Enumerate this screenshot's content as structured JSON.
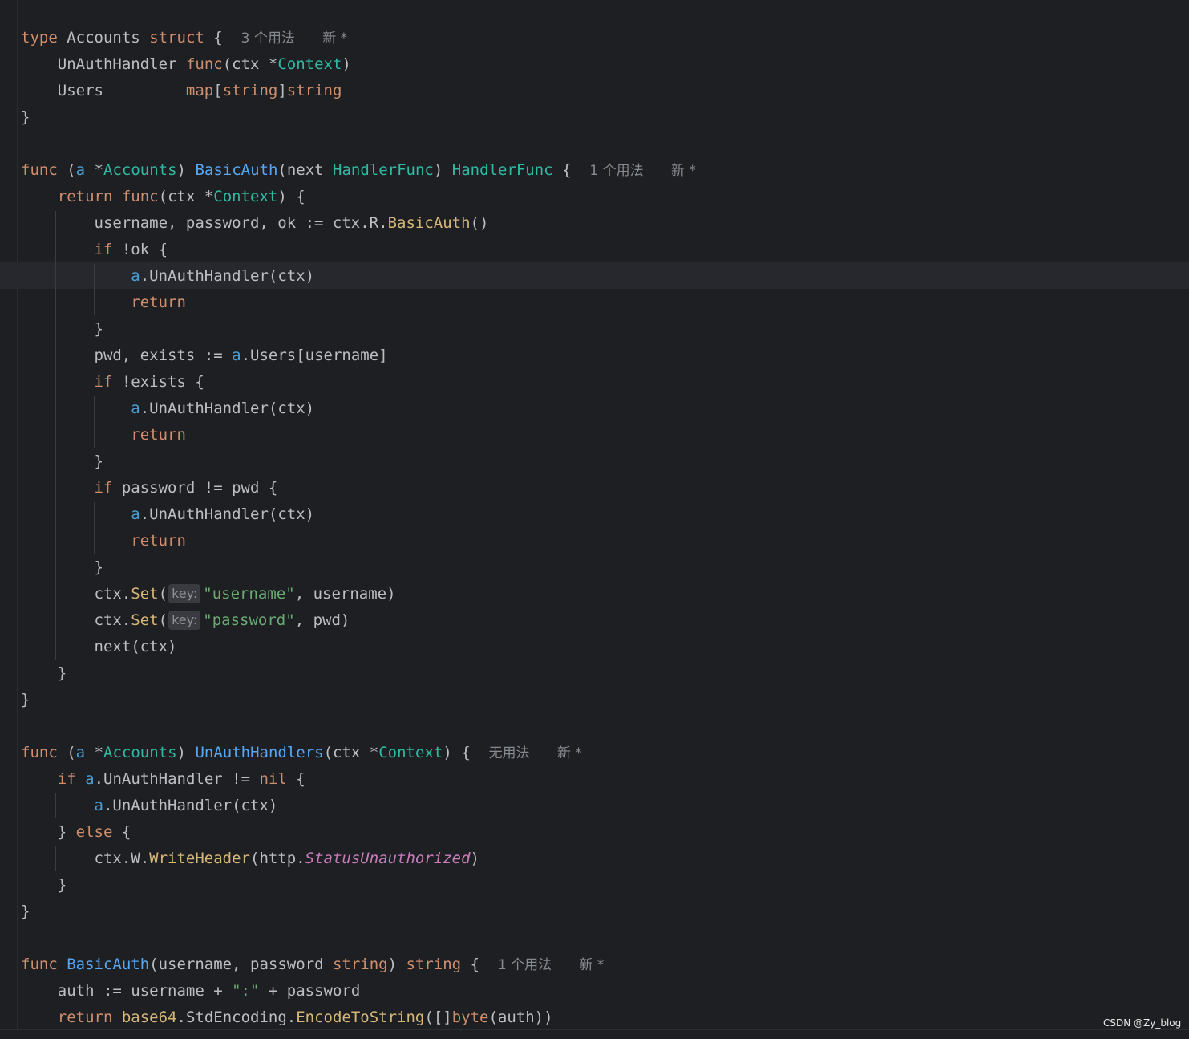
{
  "editor": {
    "lang": "go",
    "colors": {
      "background": "#1e1f22",
      "keyword": "#cf8e6d",
      "type": "#56a8f5",
      "string": "#6aab73",
      "method": "#d5b778",
      "constant": "#c77dbb"
    },
    "lines": {
      "l1": {
        "kw": "type",
        "name": "Accounts",
        "kw2": "struct",
        "brace": "{",
        "hint": "3 个用法",
        "new": "新 *"
      },
      "l2": {
        "field": "UnAuthHandler",
        "kw": "func",
        "p1": "(ctx *",
        "type": "Context",
        "p2": ")"
      },
      "l3": {
        "field": "Users",
        "map": "map",
        "b1": "[",
        "s1": "string",
        "b2": "]",
        "s2": "string"
      },
      "l4": {
        "text": "}"
      },
      "l6": {
        "kw": "func",
        "p1": "(",
        "recv": "a",
        "p2": " *",
        "type": "Accounts",
        "p3": ")",
        "name": "BasicAuth",
        "p4": "(next ",
        "t1": "HandlerFunc",
        "p5": ") ",
        "t2": "HandlerFunc",
        "brace": "{",
        "hint": "1 个用法",
        "new": "新 *"
      },
      "l7": {
        "kw": "return",
        "kw2": "func",
        "p1": "(ctx *",
        "type": "Context",
        "p2": ") {"
      },
      "l8": {
        "p1": "username, password, ok := ctx.R.",
        "call": "BasicAuth",
        "p2": "()"
      },
      "l9": {
        "kw": "if",
        "p1": " !ok {"
      },
      "l10": {
        "recv": "a",
        "p1": ".UnAuthHandler(ctx)"
      },
      "l11": {
        "kw": "return"
      },
      "l12": {
        "text": "}"
      },
      "l13": {
        "p1": "pwd, exists := ",
        "recv": "a",
        "p2": ".Users[username]"
      },
      "l14": {
        "kw": "if",
        "p1": " !exists {"
      },
      "l15": {
        "recv": "a",
        "p1": ".UnAuthHandler(ctx)"
      },
      "l16": {
        "kw": "return"
      },
      "l17": {
        "text": "}"
      },
      "l18": {
        "kw": "if",
        "p1": " password != pwd {"
      },
      "l19": {
        "recv": "a",
        "p1": ".UnAuthHandler(ctx)"
      },
      "l20": {
        "kw": "return"
      },
      "l21": {
        "text": "}"
      },
      "l22": {
        "p1": "ctx.",
        "call": "Set",
        "p2": "(",
        "inlay": "key:",
        "str": "\"username\"",
        "p3": ", username)"
      },
      "l23": {
        "p1": "ctx.",
        "call": "Set",
        "p2": "(",
        "inlay": "key:",
        "str": "\"password\"",
        "p3": ", pwd)"
      },
      "l24": {
        "text": "next(ctx)"
      },
      "l25": {
        "text": "}"
      },
      "l26": {
        "text": "}"
      },
      "l28": {
        "kw": "func",
        "p1": "(",
        "recv": "a",
        "p2": " *",
        "type": "Accounts",
        "p3": ")",
        "name": "UnAuthHandlers",
        "p4": "(ctx *",
        "t1": "Context",
        "p5": ")",
        "brace": "{",
        "hint": "无用法",
        "new": "新 *"
      },
      "l29": {
        "kw": "if",
        "recv": "a",
        "p1": ".UnAuthHandler != ",
        "nil": "nil",
        "p2": " {"
      },
      "l30": {
        "recv": "a",
        "p1": ".UnAuthHandler(ctx)"
      },
      "l31": {
        "p1": "} ",
        "kw": "else",
        "p2": " {"
      },
      "l32": {
        "p1": "ctx.W.",
        "call": "WriteHeader",
        "p2": "(http.",
        "const": "StatusUnauthorized",
        "p3": ")"
      },
      "l33": {
        "text": "}"
      },
      "l34": {
        "text": "}"
      },
      "l36": {
        "kw": "func",
        "name": "BasicAuth",
        "p1": "(username, password ",
        "t1": "string",
        "p2": ") ",
        "t2": "string",
        "brace": "{",
        "hint": "1 个用法",
        "new": "新 *"
      },
      "l37": {
        "p1": "auth := username + ",
        "str": "\":\"",
        "p2": " + password"
      },
      "l38": {
        "kw": "return",
        "pkg": "base64",
        "p1": ".StdEncoding.",
        "call": "EncodeToString",
        "p2": "([]",
        "t1": "byte",
        "p3": "(auth))"
      }
    }
  },
  "watermark": "CSDN @Zy_blog"
}
